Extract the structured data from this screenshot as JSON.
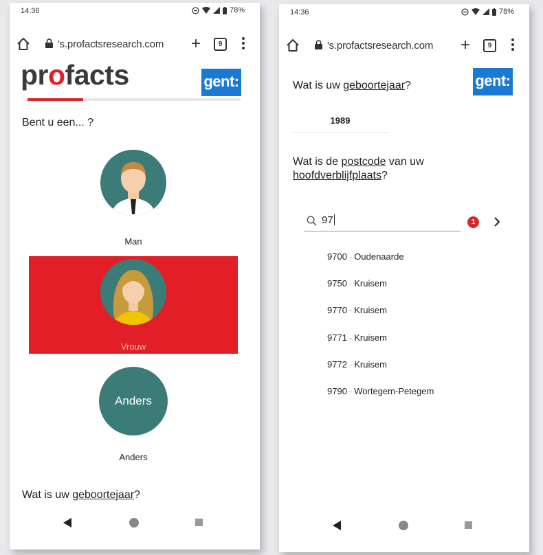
{
  "left": {
    "status": {
      "time": "14:36",
      "battery": "78%"
    },
    "url": "'s.profacts­research.com",
    "logo": {
      "pre": "pr",
      "o": "o",
      "post": "facts"
    },
    "gent_logo": "gent:",
    "progress": {
      "value_percent": 26
    },
    "question1": "Bent u een... ?",
    "options": [
      {
        "label": "Man",
        "selected": false
      },
      {
        "label": "Vrouw",
        "selected": true
      },
      {
        "label": "Anders",
        "avatar_text": "Anders",
        "selected": false
      }
    ],
    "question2": {
      "pre": "Wat is uw ",
      "link": "geboortejaar",
      "post": "?"
    }
  },
  "right": {
    "status": {
      "time": "14:36",
      "battery": "78%"
    },
    "url": "'s.profactsresearch.com",
    "gent_logo": "gent:",
    "question1": {
      "pre": "Wat is uw ",
      "link": "geboortejaar",
      "post": "?"
    },
    "year_value": "1989",
    "question2": {
      "pre": "Wat is de ",
      "link1": "postcode",
      "mid": " van uw",
      "link2": "hoofdverblijfplaats",
      "post": "?"
    },
    "search": {
      "value": "97"
    },
    "badge": "1",
    "results": [
      {
        "code": "9700",
        "sep": "-",
        "name": "Oudenaarde"
      },
      {
        "code": "9750",
        "sep": "-",
        "name": "Kruisem"
      },
      {
        "code": "9770",
        "sep": "-",
        "name": "Kruisem"
      },
      {
        "code": "9771",
        "sep": "-",
        "name": "Kruisem"
      },
      {
        "code": "9772",
        "sep": "-",
        "name": "Kruisem"
      },
      {
        "code": "9790",
        "sep": "-",
        "name": "Wortegem-Petegem"
      }
    ]
  },
  "colors": {
    "brand_red": "#d62828",
    "gent_blue": "#1a7ad1",
    "avatar_teal": "#3b7c79",
    "selected_bg": "#e21e26"
  }
}
